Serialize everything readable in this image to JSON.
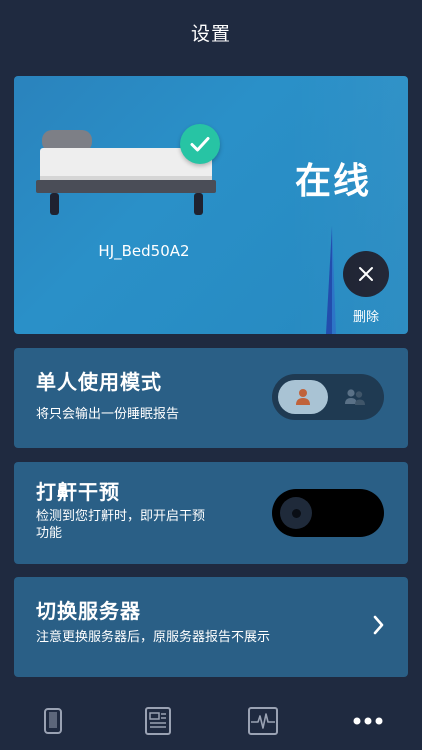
{
  "header": {
    "title": "设置"
  },
  "device": {
    "status": "在线",
    "name": "HJ_Bed50A2",
    "delete_label": "删除"
  },
  "mode_setting": {
    "title": "单人使用模式",
    "description": "将只会输出一份睡眠报告",
    "selected": "single"
  },
  "snore_setting": {
    "title": "打鼾干预",
    "description_line1": "检测到您打鼾时，即开启干预",
    "description_line2": "功能",
    "enabled": false
  },
  "server_setting": {
    "title": "切换服务器",
    "description": "注意更换服务器后，原服务器报告不展示"
  },
  "bottom_nav": {
    "items": [
      "device-icon",
      "report-icon",
      "monitor-icon",
      "more-icon"
    ],
    "active": "more-icon"
  },
  "colors": {
    "background": "#1f2a40",
    "card": "#2a5f86",
    "device_card": "#2a8cc4",
    "check": "#27c4a4"
  }
}
